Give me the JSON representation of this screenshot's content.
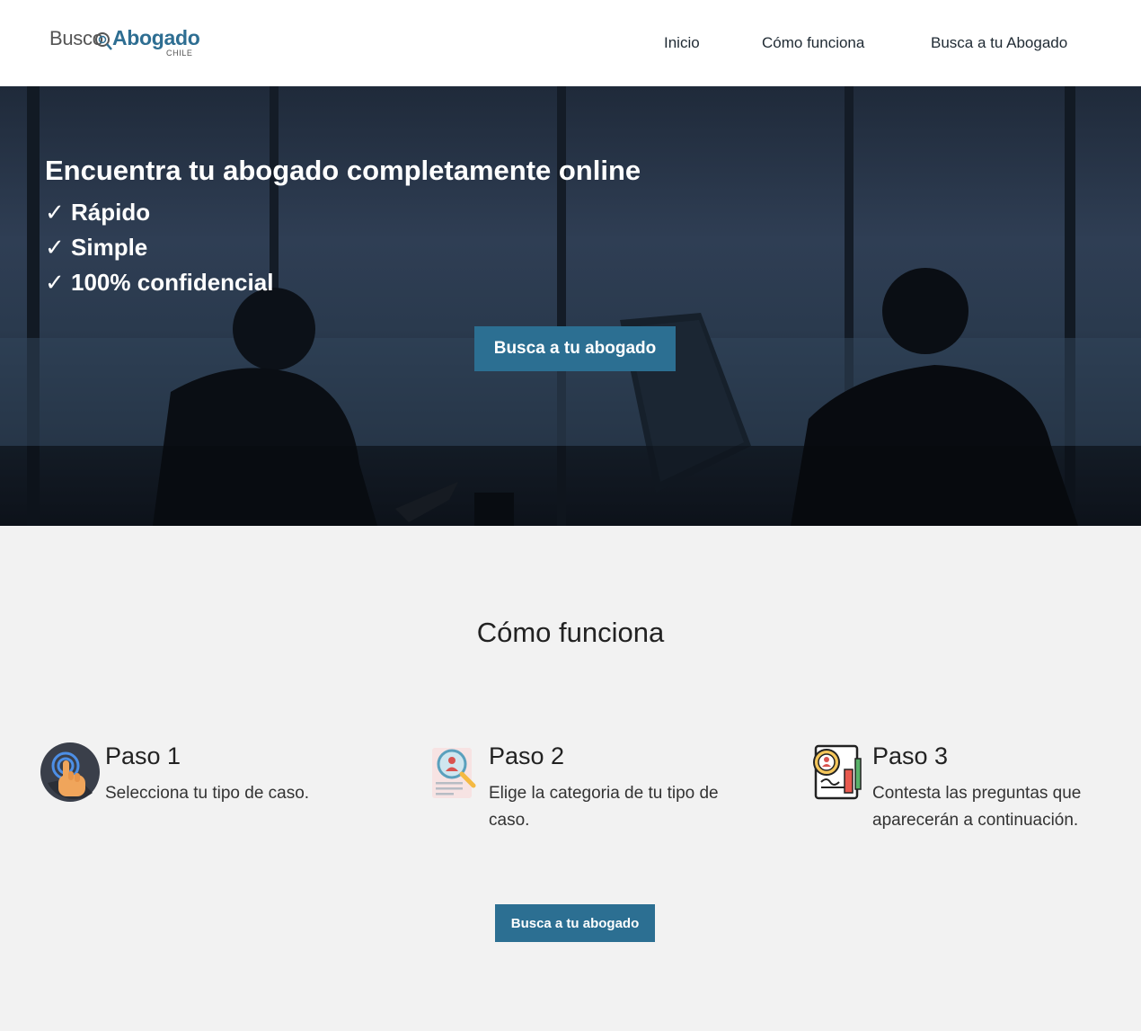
{
  "header": {
    "logo": {
      "part1": "Busco",
      "part2": "Abogado",
      "subtitle": "CHILE"
    },
    "nav": [
      {
        "label": "Inicio"
      },
      {
        "label": "Cómo funciona"
      },
      {
        "label": "Busca a tu Abogado"
      }
    ]
  },
  "hero": {
    "title": "Encuentra tu abogado completamente online",
    "bullets": [
      "✓ Rápido",
      "✓ Simple",
      "✓ 100% confidencial"
    ],
    "cta_label": "Busca a tu abogado"
  },
  "how_it_works": {
    "title": "Cómo funciona",
    "steps": [
      {
        "title": "Paso 1",
        "description": "Selecciona tu tipo de caso.",
        "icon": "touch-icon"
      },
      {
        "title": "Paso 2",
        "description": "Elige la categoria de tu tipo de caso.",
        "icon": "magnifier-profile-icon"
      },
      {
        "title": "Paso 3",
        "description": "Contesta las preguntas que aparecerán a continuación.",
        "icon": "contract-icon"
      }
    ],
    "cta_label": "Busca a tu abogado"
  },
  "colors": {
    "brand": "#2c6f92",
    "logo_accent": "#2e6e92",
    "page_bg": "#f2f2f2"
  }
}
